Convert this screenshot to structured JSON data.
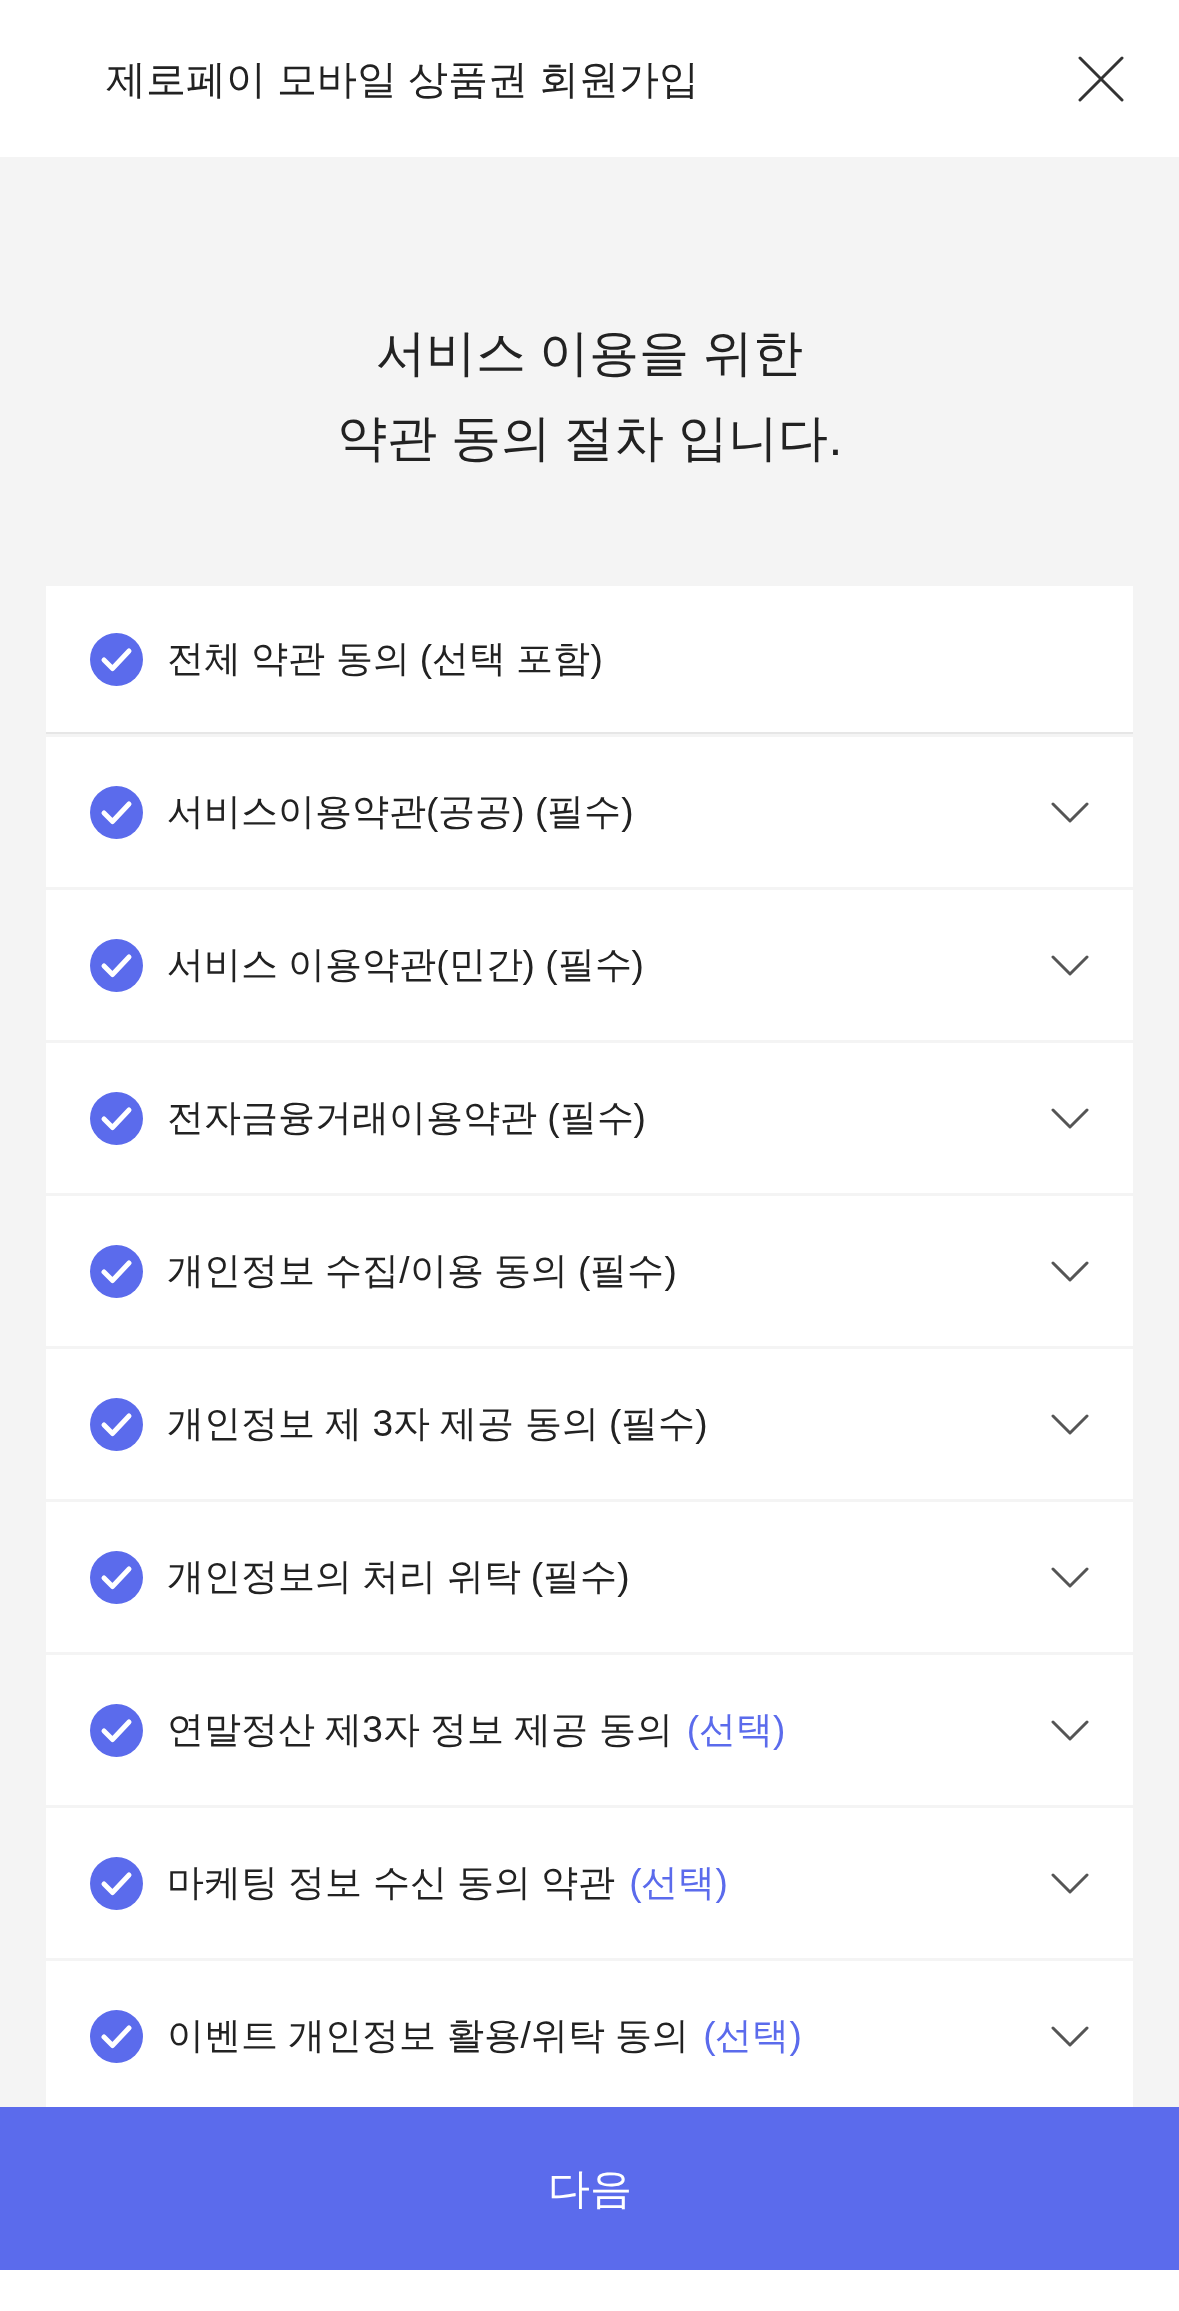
{
  "header": {
    "title": "제로페이 모바일 상품권 회원가입"
  },
  "heading": [
    "서비스 이용을 위한",
    "약관 동의 절차 입니다."
  ],
  "terms": [
    {
      "kind": "all",
      "label": "전체 약관 동의 (선택 포함)",
      "checked": true
    },
    {
      "kind": "term",
      "label": "서비스이용약관(공공) (필수)",
      "checked": true,
      "expanded": false
    },
    {
      "kind": "term",
      "label": "서비스 이용약관(민간) (필수)",
      "checked": true,
      "expanded": false
    },
    {
      "kind": "term",
      "label": "전자금융거래이용약관 (필수)",
      "checked": true,
      "expanded": false
    },
    {
      "kind": "term",
      "label": "개인정보 수집/이용 동의 (필수)",
      "checked": true,
      "expanded": false
    },
    {
      "kind": "term",
      "label": "개인정보 제 3자 제공 동의 (필수)",
      "checked": true,
      "expanded": false
    },
    {
      "kind": "term",
      "label": "개인정보의 처리 위탁 (필수)",
      "checked": true,
      "expanded": false
    },
    {
      "kind": "term",
      "label": "연말정산 제3자 정보 제공 동의",
      "tag": "(선택)",
      "checked": true,
      "expanded": false
    },
    {
      "kind": "term",
      "label": "마케팅 정보 수신 동의 약관",
      "tag": "(선택)",
      "checked": true,
      "expanded": false
    },
    {
      "kind": "term",
      "label": "이벤트 개인정보 활용/위탁 동의",
      "tag": "(선택)",
      "checked": true,
      "expanded": false
    }
  ],
  "next_button": {
    "label": "다음"
  }
}
